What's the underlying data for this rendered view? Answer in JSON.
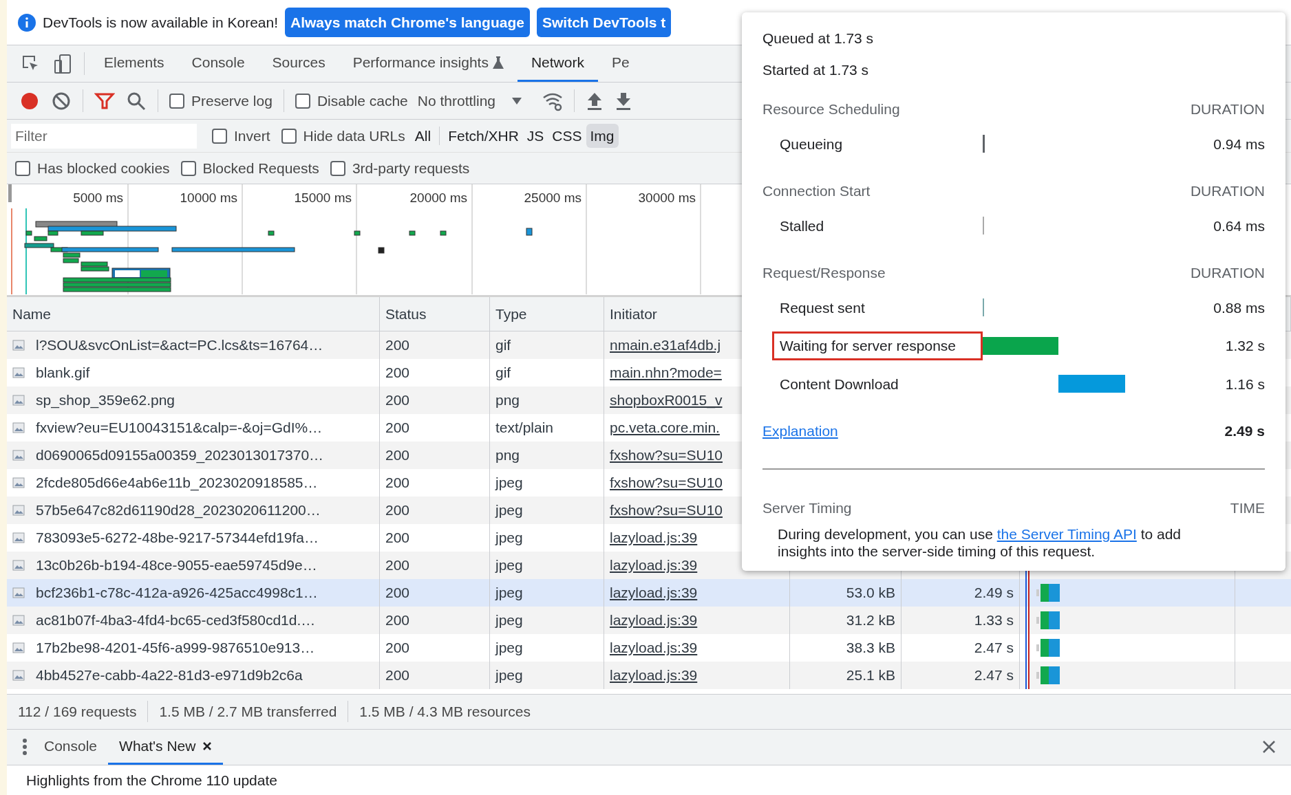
{
  "infobar": {
    "message": "DevTools is now available in Korean!",
    "buttons": [
      "Always match Chrome's language",
      "Switch DevTools t"
    ]
  },
  "panel_tabs": [
    {
      "label": "Elements",
      "selected": false,
      "experimental": false
    },
    {
      "label": "Console",
      "selected": false,
      "experimental": false
    },
    {
      "label": "Sources",
      "selected": false,
      "experimental": false
    },
    {
      "label": "Performance insights",
      "selected": false,
      "experimental": true
    },
    {
      "label": "Network",
      "selected": true,
      "experimental": false
    },
    {
      "label": "Pe",
      "selected": false,
      "experimental": false
    }
  ],
  "toolbar": {
    "recording": true,
    "filter_shown": true,
    "preserve_log": false,
    "disable_cache": false,
    "throttling": "No throttling"
  },
  "filter": {
    "placeholder": "Filter",
    "invert": false,
    "hide_data_urls": false,
    "invert_label": "Invert",
    "hide_data_urls_label": "Hide data URLs",
    "types": [
      {
        "label": "All",
        "selected": false
      },
      {
        "label": "Fetch/XHR",
        "selected": false
      },
      {
        "label": "JS",
        "selected": false
      },
      {
        "label": "CSS",
        "selected": false
      },
      {
        "label": "Img",
        "selected": true
      }
    ]
  },
  "more_filters": [
    {
      "label": "Has blocked cookies",
      "checked": false
    },
    {
      "label": "Blocked Requests",
      "checked": false
    },
    {
      "label": "3rd-party requests",
      "checked": false
    }
  ],
  "preserve_log_label": "Preserve log",
  "disable_cache_label": "Disable cache",
  "overview": {
    "ticks": [
      "5000 ms",
      "10000 ms",
      "15000 ms",
      "20000 ms",
      "25000 ms",
      "30000 ms"
    ]
  },
  "table": {
    "columns": [
      "Name",
      "Status",
      "Type",
      "Initiator"
    ],
    "rows": [
      {
        "name": "l?SOU&svcOnList=&act=PC.lcs&ts=16764…",
        "status": "200",
        "type": "gif",
        "initiator": "nmain.e31af4db.j",
        "selected": false
      },
      {
        "name": "blank.gif",
        "status": "200",
        "type": "gif",
        "initiator": "main.nhn?mode=",
        "selected": false
      },
      {
        "name": "sp_shop_359e62.png",
        "status": "200",
        "type": "png",
        "initiator": "shopboxR0015_v",
        "selected": false
      },
      {
        "name": "fxview?eu=EU10043151&calp=-&oj=GdI%…",
        "status": "200",
        "type": "text/plain",
        "initiator": "pc.veta.core.min.",
        "selected": false
      },
      {
        "name": "d0690065d09155a00359_2023013017370…",
        "status": "200",
        "type": "png",
        "initiator": "fxshow?su=SU10",
        "selected": false
      },
      {
        "name": "2fcde805d66e4ab6e11b_202302091858​5…",
        "status": "200",
        "type": "jpeg",
        "initiator": "fxshow?su=SU10",
        "selected": false
      },
      {
        "name": "57b5e647c82d61190d28_2023020611200…",
        "status": "200",
        "type": "jpeg",
        "initiator": "fxshow?su=SU10",
        "selected": false
      },
      {
        "name": "783093e5-6272-48be-9217-57344efd19fa…",
        "status": "200",
        "type": "jpeg",
        "initiator": "lazyload.js:39",
        "selected": false
      },
      {
        "name": "13c0b26b-b194-48ce-9055-eae59745d9e…",
        "status": "200",
        "type": "jpeg",
        "initiator": "lazyload.js:39",
        "selected": false
      },
      {
        "name": "bcf236b1-c78c-412a-a926-425acc4998c1…",
        "status": "200",
        "type": "jpeg",
        "initiator": "lazyload.js:39",
        "size": "53.0 kB",
        "time": "2.49 s",
        "selected": true
      },
      {
        "name": "ac81b07f-4ba3-4fd4-bc65-ced3f580cd1d.…",
        "status": "200",
        "type": "jpeg",
        "initiator": "lazyload.js:39",
        "size": "31.2 kB",
        "time": "1.33 s",
        "selected": false
      },
      {
        "name": "17b2be98-4201-45f6-a999-9876510e913…",
        "status": "200",
        "type": "jpeg",
        "initiator": "lazyload.js:39",
        "size": "38.3 kB",
        "time": "2.47 s",
        "selected": false
      },
      {
        "name": "4bb4527e-cabb-4a22-81d3-e971d9b2c6a",
        "status": "200",
        "type": "jpeg",
        "initiator": "lazyload.js:39",
        "size": "25.1 kB",
        "time": "2.47 s",
        "selected": false
      }
    ]
  },
  "status_bar": [
    "112 / 169 requests",
    "1.5 MB / 2.7 MB transferred",
    "1.5 MB / 4.3 MB resources"
  ],
  "drawer": {
    "tabs": [
      {
        "label": "Console",
        "selected": false,
        "closable": false
      },
      {
        "label": "What's New",
        "selected": true,
        "closable": true
      }
    ],
    "content": "Highlights from the Chrome 110 update"
  },
  "timing_popup": {
    "queued": "Queued at 1.73 s",
    "started": "Started at 1.73 s",
    "sections": [
      {
        "title": "Resource Scheduling",
        "column": "DURATION",
        "rows": [
          {
            "label": "Queueing",
            "kind": "queue-tick",
            "duration": "0.94 ms",
            "highlighted": false
          }
        ]
      },
      {
        "title": "Connection Start",
        "column": "DURATION",
        "rows": [
          {
            "label": "Stalled",
            "kind": "tick",
            "duration": "0.64 ms",
            "highlighted": false
          }
        ]
      },
      {
        "title": "Request/Response",
        "column": "DURATION",
        "rows": [
          {
            "label": "Request sent",
            "kind": "sent-tick",
            "duration": "0.88 ms",
            "highlighted": false
          },
          {
            "label": "Waiting for server response",
            "kind": "wait",
            "duration": "1.32 s",
            "highlighted": true
          },
          {
            "label": "Content Download",
            "kind": "download",
            "duration": "1.16 s",
            "highlighted": false
          }
        ]
      }
    ],
    "explanation": "Explanation",
    "total": "2.49 s",
    "server_timing": {
      "title": "Server Timing",
      "column": "TIME",
      "text_before": "During development, you can use ",
      "link": "the Server Timing API",
      "text_after": " to add insights into the server-side timing of this request."
    }
  }
}
